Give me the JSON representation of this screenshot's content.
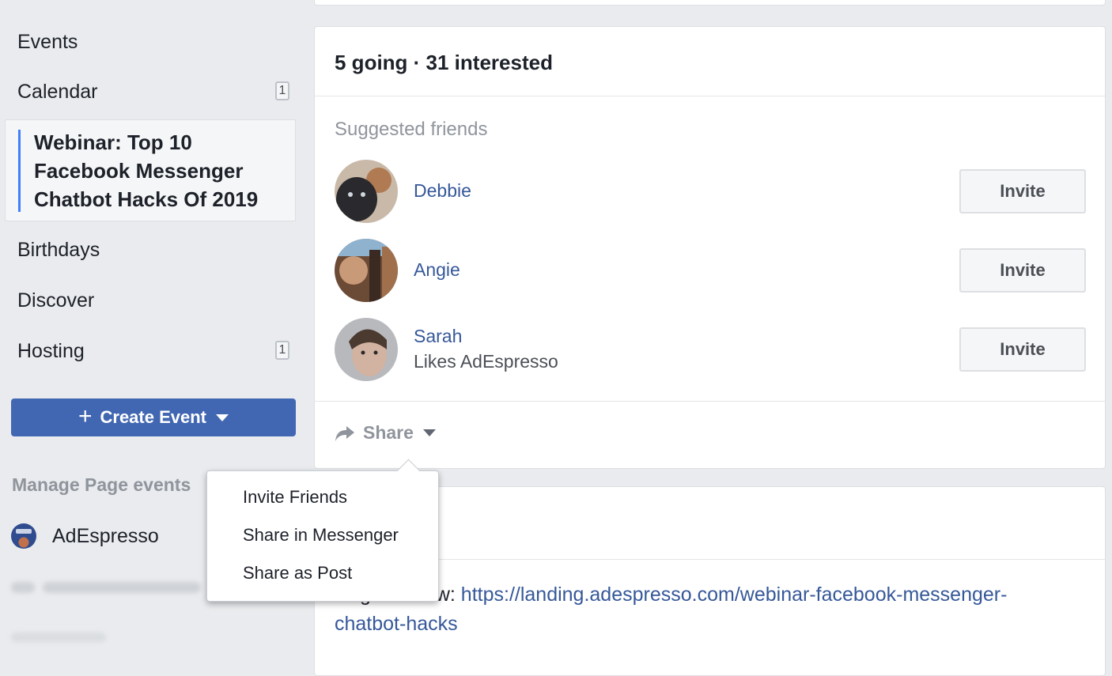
{
  "sidebar": {
    "items": [
      {
        "label": "Events",
        "badge": null
      },
      {
        "label": "Calendar",
        "badge": "1"
      },
      {
        "label": "Birthdays",
        "badge": null
      },
      {
        "label": "Discover",
        "badge": null
      },
      {
        "label": "Hosting",
        "badge": "1"
      }
    ],
    "selected_event": "Webinar: Top 10 Facebook Messenger Chatbot Hacks Of 2019",
    "create_event_label": "Create Event",
    "manage_heading": "Manage Page events",
    "pages": [
      {
        "name": "AdEspresso"
      }
    ]
  },
  "event_card": {
    "stats": "5 going · 31 interested",
    "suggested_label": "Suggested friends",
    "friends": [
      {
        "name": "Debbie",
        "subtitle": null,
        "invite_label": "Invite"
      },
      {
        "name": "Angie",
        "subtitle": null,
        "invite_label": "Invite"
      },
      {
        "name": "Sarah",
        "subtitle": "Likes AdEspresso",
        "invite_label": "Invite"
      }
    ],
    "share_label": "Share"
  },
  "share_menu": {
    "items": [
      "Invite Friends",
      "Share in Messenger",
      "Share as Post"
    ]
  },
  "details_card": {
    "prefix": "Register now: ",
    "link_text": "https://landing.adespresso.com/webinar-facebook-messenger-chatbot-hacks"
  },
  "colors": {
    "page_bg": "#e9ebee",
    "brand_blue": "#4267b2",
    "link_blue": "#365899",
    "selected_accent": "#4080ff",
    "muted_text": "#90949c"
  }
}
